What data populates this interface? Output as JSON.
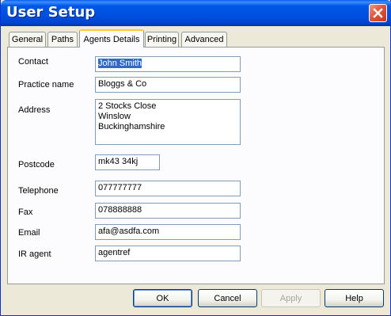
{
  "window": {
    "title": "User Setup"
  },
  "tabs": [
    {
      "label": "General",
      "active": false
    },
    {
      "label": "Paths",
      "active": false
    },
    {
      "label": "Agents Details",
      "active": true
    },
    {
      "label": "Printing",
      "active": false
    },
    {
      "label": "Advanced",
      "active": false
    }
  ],
  "form": {
    "contact_label": "Contact",
    "contact_value": "John Smith",
    "practice_label": "Practice name",
    "practice_value": "Bloggs & Co",
    "address_label": "Address",
    "address_lines": [
      "2 Stocks Close",
      "Winslow",
      "Buckinghamshire"
    ],
    "postcode_label": "Postcode",
    "postcode_value": "mk43 34kj",
    "telephone_label": "Telephone",
    "telephone_value": "077777777",
    "fax_label": "Fax",
    "fax_value": "078888888",
    "email_label": "Email",
    "email_value": "afa@asdfa.com",
    "ir_agent_label": "IR agent",
    "ir_agent_value": "agentref"
  },
  "buttons": {
    "ok": "OK",
    "cancel": "Cancel",
    "apply": "Apply",
    "help": "Help"
  },
  "icons": {
    "close": "close-icon"
  },
  "colors": {
    "titlebar": "#0058e6",
    "close_button": "#e0563a",
    "active_tab_accent": "#ffc83c",
    "selection": "#316ac5"
  }
}
